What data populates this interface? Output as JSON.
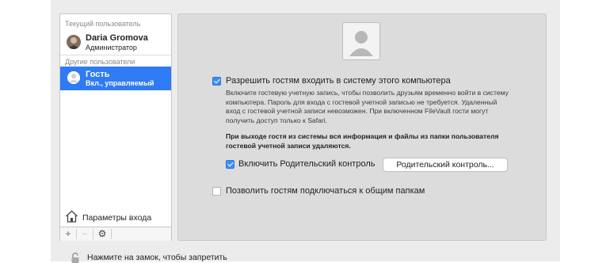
{
  "sidebar": {
    "current_user_label": "Текущий пользователь",
    "current_user": {
      "name": "Daria Gromova",
      "role": "Администратор"
    },
    "other_users_label": "Другие пользователи",
    "guest": {
      "name": "Гость",
      "status": "Вкл., управляемый"
    },
    "login_options": "Параметры входа",
    "add": "+",
    "remove": "−",
    "gear": "⚙"
  },
  "main": {
    "allow_login": "Разрешить гостям входить в систему этого компьютера",
    "allow_login_checked": true,
    "description": "Включите гостевую учетную запись, чтобы позволить друзьям временно войти в систему компьютера. Пароль для входа с гостевой учетной записью не требуется. Удаленный вход с гостевой учетной записи невозможен. При включенном FileVault гости могут получить доступ только к Safari.",
    "description_bold": "При выходе гостя из системы вся информация и файлы из папки пользователя гостевой учетной записи удаляются.",
    "parental_control": "Включить Родительский контроль",
    "parental_control_checked": true,
    "parental_button": "Родительский контроль...",
    "shared_folders": "Позволить гостям подключаться к общим папкам",
    "shared_folders_checked": false
  },
  "footer": {
    "lock_text": "Нажмите на замок, чтобы запретить"
  },
  "colors": {
    "selection": "#2f7bf5",
    "checkbox": "#3a8ef6"
  }
}
